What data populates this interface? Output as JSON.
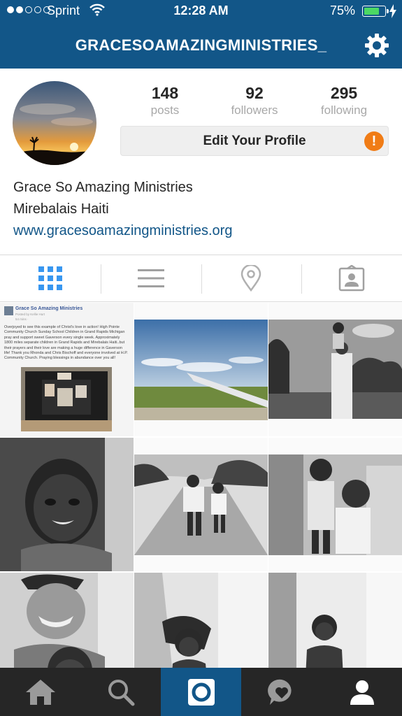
{
  "status_bar": {
    "carrier": "Sprint",
    "time": "12:28 AM",
    "battery_percent": "75%",
    "battery_level": 0.75,
    "signal_bars_filled": 2,
    "signal_bars_total": 5
  },
  "header": {
    "username": "GRACESOAMAZINGMINISTRIES_",
    "settings_icon": "gear-icon"
  },
  "profile": {
    "stats": [
      {
        "value": "148",
        "label": "posts"
      },
      {
        "value": "92",
        "label": "followers"
      },
      {
        "value": "295",
        "label": "following"
      }
    ],
    "edit_button_label": "Edit Your Profile",
    "alert_symbol": "!",
    "full_name": "Grace So Amazing Ministries",
    "location": "Mirebalais Haiti",
    "website": "www.gracesoamazingministries.org"
  },
  "view_tabs": [
    {
      "icon": "grid-icon",
      "active": true
    },
    {
      "icon": "list-icon",
      "active": false
    },
    {
      "icon": "location-pin-icon",
      "active": false
    },
    {
      "icon": "tagged-photos-icon",
      "active": false
    }
  ],
  "posts": {
    "first_post": {
      "title": "Grace So Amazing Ministries",
      "byline": "Posted by Kellie Hurt",
      "meta": "54 mins · ",
      "body": "Overjoyed to see this example of Christ's love in action! High Pointe Community Church Sunday School Children in Grand Rapids Michigan pray and support sweet Gaverson every single week. Approximately 1800 miles separate children in Grand Rapids and Mirebalais Haiti..but their prayers and their love are making a huge difference in Gaverson life! Thank you Rhonda and Chris Bischoff and everyone involved at H.P. Community Church. Praying blessings in abundance over you all!"
    }
  },
  "bottom_nav": [
    {
      "icon": "home-icon",
      "active": false
    },
    {
      "icon": "search-icon",
      "active": false
    },
    {
      "icon": "camera-icon",
      "active": true
    },
    {
      "icon": "activity-icon",
      "active": false
    },
    {
      "icon": "profile-icon",
      "active": false
    }
  ],
  "colors": {
    "brand": "#125688",
    "alert": "#f07c16",
    "nav_bg": "#262626",
    "battery": "#4cd964",
    "grid_icon_active": "#3897f0"
  }
}
